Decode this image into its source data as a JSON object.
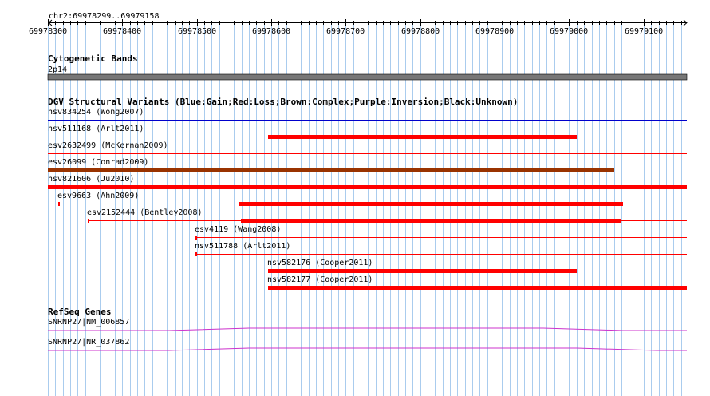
{
  "ruler": {
    "position_label": "chr2:69978299..69979158",
    "start": 69978300,
    "end": 69979158,
    "ticks": [
      "69978300",
      "69978400",
      "69978500",
      "69978600",
      "69978700",
      "69978800",
      "69978900",
      "69979000",
      "69979100"
    ]
  },
  "cytoband": {
    "title": "Cytogenetic Bands",
    "band": "2p14",
    "color": "#777777"
  },
  "dgv": {
    "title": "DGV Structural Variants (Blue:Gain;Red:Loss;Brown:Complex;Purple:Inversion;Black:Unknown)",
    "colors": {
      "gain": "#0000cc",
      "loss": "#ff0000",
      "complex": "#993300",
      "unknown": "#000000"
    },
    "variants": [
      {
        "label": "nsv834254 (Wong2007)",
        "type": "gain",
        "start": 69978300,
        "end": 69979158,
        "thick": null
      },
      {
        "label": "nsv511168 (Arlt2011)",
        "type": "loss",
        "start": 69978300,
        "end": 69979158,
        "thick": [
          69978596,
          69979010
        ]
      },
      {
        "label": "esv2632499 (McKernan2009)",
        "type": "loss",
        "start": 69978300,
        "end": 69979158,
        "thick": null
      },
      {
        "label": "esv26099 (Conrad2009)",
        "type": "complex",
        "start": 69978300,
        "end": 69979060,
        "thick": [
          69978300,
          69979060
        ]
      },
      {
        "label": "nsv821606 (Ju2010)",
        "type": "loss",
        "start": 69978300,
        "end": 69979158,
        "thick": [
          69978300,
          69979158
        ]
      },
      {
        "label": "esv9663 (Ahn2009)",
        "type": "loss",
        "start": 69978314,
        "end": 69979158,
        "thick": [
          69978557,
          69979072
        ]
      },
      {
        "label": "esv2152444 (Bentley2008)",
        "type": "loss",
        "start": 69978354,
        "end": 69979158,
        "thick": [
          69978559,
          69979070
        ]
      },
      {
        "label": "esv4119 (Wang2008)",
        "type": "loss",
        "start": 69978498,
        "end": 69979158,
        "thick": null
      },
      {
        "label": "nsv511788 (Arlt2011)",
        "type": "loss",
        "start": 69978498,
        "end": 69979158,
        "thick": null
      },
      {
        "label": "nsv582176 (Cooper2011)",
        "type": "loss",
        "start": 69978596,
        "end": 69979010,
        "thick": [
          69978596,
          69979010
        ]
      },
      {
        "label": "nsv582177 (Cooper2011)",
        "type": "loss",
        "start": 69978596,
        "end": 69979158,
        "thick": [
          69978596,
          69979158
        ]
      }
    ]
  },
  "refseq": {
    "title": "RefSeq Genes",
    "color": "#cc33cc",
    "genes": [
      {
        "label": "SNRNP27|NM_006857",
        "bump": [
          69978570,
          69978965
        ]
      },
      {
        "label": "SNRNP27|NR_037862",
        "bump": [
          69978570,
          69979010
        ]
      }
    ]
  },
  "colors": {
    "grid": "#aaccee",
    "ruler": "#000000"
  }
}
